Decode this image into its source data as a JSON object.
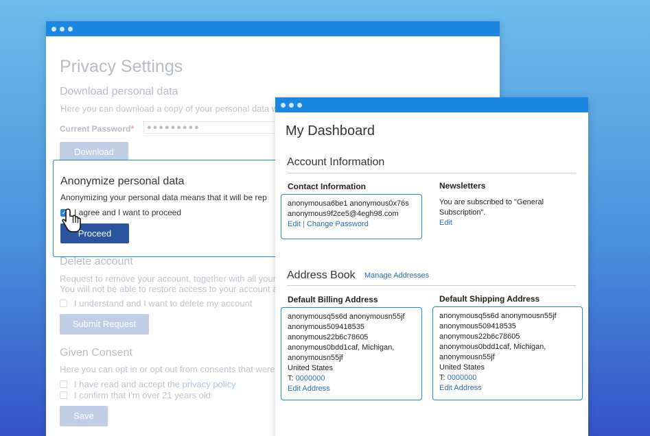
{
  "privacy": {
    "title": "Privacy Settings",
    "download": {
      "heading": "Download personal data",
      "description": "Here you can download a copy of your personal data wh",
      "password_label": "Current Password",
      "required_mark": "*",
      "password_value": "●●●●●●●●●",
      "button": "Download"
    },
    "anonymize": {
      "heading": "Anonymize personal data",
      "description": "Anonymizing your personal data means that it will be rep",
      "checkbox_label": "I agree and I want to proceed",
      "checkbox_checked": true,
      "button": "Proceed"
    },
    "delete": {
      "heading": "Delete account",
      "description_1": "Request to remove your account, together with all your p",
      "description_2": "You will not be able to restore access to your account aft",
      "checkbox_label": "I understand and I want to delete my account",
      "button": "Submit Request"
    },
    "consent": {
      "heading": "Given Consent",
      "description": "Here you can opt in or opt out from consents that were p",
      "checkbox1_prefix": "I have read and accept the ",
      "checkbox1_link": "privacy policy",
      "checkbox2_label": "I confirm that I'm over 21 years old",
      "button": "Save"
    }
  },
  "dashboard": {
    "title": "My Dashboard",
    "account_info": {
      "heading": "Account Information",
      "contact": {
        "heading": "Contact Information",
        "name": "anonymousa6be1 anonymous0x76s",
        "email": "anonymous9f2ce5@4egh98.com",
        "edit_link": "Edit",
        "separator": "|",
        "change_password_link": "Change Password"
      },
      "newsletters": {
        "heading": "Newsletters",
        "line1": "You are subscribed to \"General",
        "line2": "Subscription\".",
        "edit_link": "Edit"
      }
    },
    "address_book": {
      "heading": "Address Book",
      "manage_link": "Manage Addresses",
      "billing": {
        "heading": "Default Billing Address",
        "lines": [
          "anonymousq5s6d anonymousn55jf",
          "anonymous509418535",
          "anonymous22b6c78605",
          "anonymous0bdd1caf, Michigan,",
          "anonymousn55jf",
          "United States"
        ],
        "phone_prefix": "T: ",
        "phone": "0000000",
        "edit_link": "Edit Address"
      },
      "shipping": {
        "heading": "Default Shipping Address",
        "lines": [
          "anonymousq5s6d anonymousn55jf",
          "anonymous509418535",
          "anonymous22b6c78605",
          "anonymous0bdd1caf, Michigan,",
          "anonymousn55jf",
          "United States"
        ],
        "phone_prefix": "T: ",
        "phone": "0000000",
        "edit_link": "Edit Address"
      }
    }
  },
  "colors": {
    "accent": "#1b87e3",
    "primary_button": "#2a53a0",
    "link": "#2b6cb5"
  },
  "icons": [
    "window-dot-icon",
    "hand-pointer-icon",
    "checkmark-icon"
  ]
}
